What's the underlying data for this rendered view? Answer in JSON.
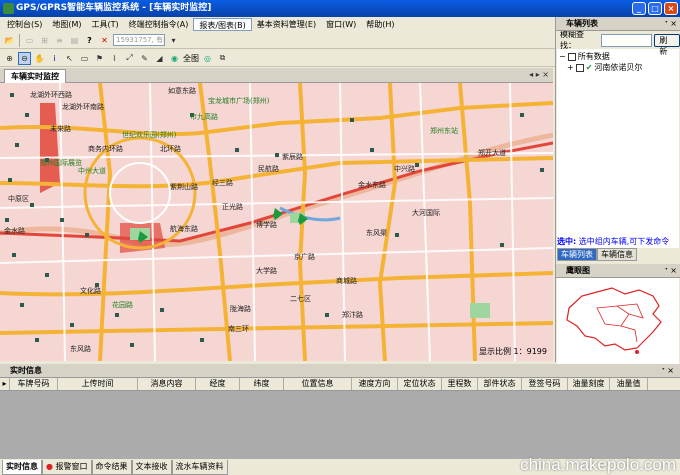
{
  "window": {
    "title": "GPS/GPRS智能车辆监控系统 - [车辆实时监控]"
  },
  "menu": [
    "控制台(S)",
    "地图(M)",
    "工具(T)",
    "终端控制指令(A)",
    "报表/图表(B)",
    "基本资料管理(E)",
    "窗口(W)",
    "帮助(H)"
  ],
  "toolbar": {
    "search_value": "15931757, 有问题!"
  },
  "doc_tab": "车辆实时监控",
  "map": {
    "scale_text": "显示比例 1：9199",
    "labels": [
      {
        "t": "龙湖外环西路"
      },
      {
        "t": "龙湖外环南路"
      },
      {
        "t": "如意东路"
      },
      {
        "t": "宝龙城市广场(郑州)"
      },
      {
        "t": "市九高路"
      },
      {
        "t": "未来路"
      },
      {
        "t": "世纪欢乐园(郑州)"
      },
      {
        "t": "商务内环路"
      },
      {
        "t": "紫荆山路"
      },
      {
        "t": "北环路"
      },
      {
        "t": "中州大道"
      },
      {
        "t": "郑州国际展览"
      },
      {
        "t": "金水东路"
      },
      {
        "t": "郑开大道"
      },
      {
        "t": "航海东路"
      },
      {
        "t": "东风渠"
      },
      {
        "t": "金水路"
      },
      {
        "t": "商城路"
      },
      {
        "t": "正光路"
      },
      {
        "t": "中兴路"
      },
      {
        "t": "博学路"
      },
      {
        "t": "大河国际"
      },
      {
        "t": "郑州东站"
      },
      {
        "t": "紫辰路"
      },
      {
        "t": "民航路"
      },
      {
        "t": "经三路"
      },
      {
        "t": "南三环"
      },
      {
        "t": "陇海路"
      },
      {
        "t": "郑汴路"
      },
      {
        "t": "二七区"
      },
      {
        "t": "中原区"
      },
      {
        "t": "文化路"
      },
      {
        "t": "东风路"
      },
      {
        "t": "花园路"
      },
      {
        "t": "京广路"
      },
      {
        "t": "大学路"
      }
    ]
  },
  "right_panel": {
    "title": "车辆列表",
    "fuzzy_label": "模糊查找：",
    "refresh_btn": "刷新",
    "tree": [
      "所有数据",
      "河南依诺贝尔"
    ],
    "select_label": "选中:",
    "select_value": "选中组内车辆,可下发命令",
    "tabs": [
      "车辆列表",
      "车辆信息"
    ],
    "eagle_title": "鹰眼图"
  },
  "info": {
    "title": "实时信息",
    "columns": [
      "车牌号码",
      "上传时间",
      "消息内容",
      "经度",
      "纬度",
      "位置信息",
      "速度方向",
      "定位状态",
      "里程数",
      "部件状态",
      "登签号码",
      "油量刻度",
      "油量值"
    ]
  },
  "bottom_tabs": [
    "实时信息",
    "报警窗口",
    "命令结果",
    "文本接收",
    "流水车辆资料"
  ],
  "watermark": "china.makepolo.com"
}
